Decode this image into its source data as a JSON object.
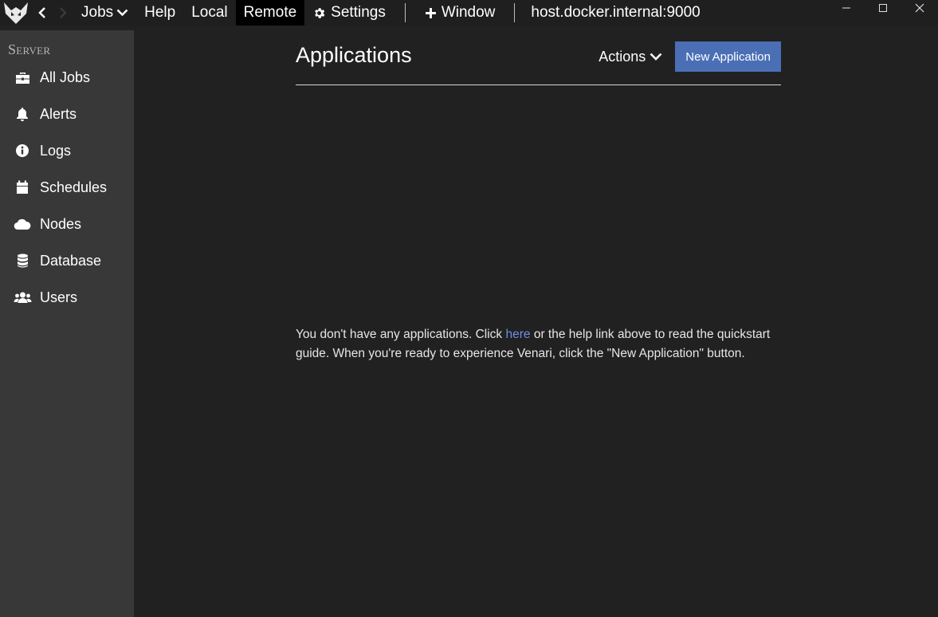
{
  "menu": {
    "jobs": "Jobs",
    "help": "Help",
    "local": "Local",
    "remote": "Remote",
    "settings": "Settings",
    "window": "Window",
    "host": "host.docker.internal:9000"
  },
  "sidebar": {
    "section": "Server",
    "items": [
      {
        "label": "All Jobs",
        "icon": "briefcase-icon"
      },
      {
        "label": "Alerts",
        "icon": "bell-icon"
      },
      {
        "label": "Logs",
        "icon": "info-icon"
      },
      {
        "label": "Schedules",
        "icon": "calendar-icon"
      },
      {
        "label": "Nodes",
        "icon": "cloud-icon"
      },
      {
        "label": "Database",
        "icon": "database-icon"
      },
      {
        "label": "Users",
        "icon": "users-icon"
      }
    ]
  },
  "main": {
    "title": "Applications",
    "actions_label": "Actions",
    "new_button": "New Application",
    "empty_before": "You don't have any applications. Click ",
    "empty_link": "here",
    "empty_after": " or the help link above to read the quickstart guide. When you're ready to experience Venari, click the \"New Application\" button."
  },
  "colors": {
    "accent": "#4a6fb5",
    "link": "#6c8ee6",
    "sidebar_bg": "#383838",
    "main_bg": "#212121"
  }
}
